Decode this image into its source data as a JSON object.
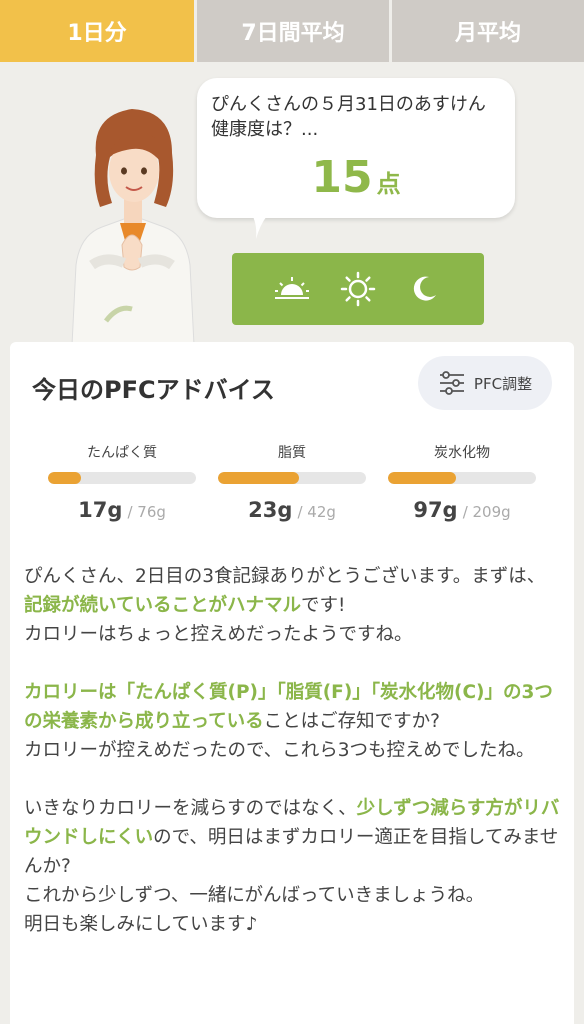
{
  "tabs": [
    {
      "label": "1日分",
      "active": true
    },
    {
      "label": "7日間平均",
      "active": false
    },
    {
      "label": "月平均",
      "active": false
    }
  ],
  "bubble": {
    "line1": "ぴんくさんの５月31日のあすけん",
    "line2": "健康度は？...",
    "score": "15",
    "unit": "点"
  },
  "meals": [
    {
      "icon": "sunrise-icon"
    },
    {
      "icon": "sun-icon"
    },
    {
      "icon": "moon-icon"
    }
  ],
  "card": {
    "title": "今日のPFCアドバイス",
    "pfc_button": "PFC調整"
  },
  "nutrients": [
    {
      "label": "たんぱく質",
      "current": "17g",
      "goal": "/ 76g",
      "progress": 0.22
    },
    {
      "label": "脂質",
      "current": "23g",
      "goal": "/ 42g",
      "progress": 0.55
    },
    {
      "label": "炭水化物",
      "current": "97g",
      "goal": "/ 209g",
      "progress": 0.46
    }
  ],
  "advice": {
    "p1_a": "ぴんくさん、2日目の3食記録ありがとうございます。まずは、",
    "p1_hl": "記録が続いていることがハナマル",
    "p1_b": "です!",
    "p1_c": "カロリーはちょっと控えめだったようですね。",
    "p2_hl": "カロリーは「たんぱく質(P)」「脂質(F)」「炭水化物(C)」の3つの栄養素から成り立っている",
    "p2_a": "ことはご存知ですか?",
    "p2_b": "カロリーが控えめだったので、これら3つも控えめでしたね。",
    "p3_a": "いきなりカロリーを減らすのではなく、",
    "p3_hl": "少しずつ減らす方がリバウンドしにくい",
    "p3_b": "ので、明日はまずカロリー適正を目指してみませんか?",
    "p3_c": "これから少しずつ、一緒にがんばっていきましょうね。",
    "p3_d": "明日も楽しみにしています♪"
  },
  "colors": {
    "accent_green": "#8bb64a",
    "tab_active": "#f2c14a",
    "bar_fill": "#eaa233"
  }
}
